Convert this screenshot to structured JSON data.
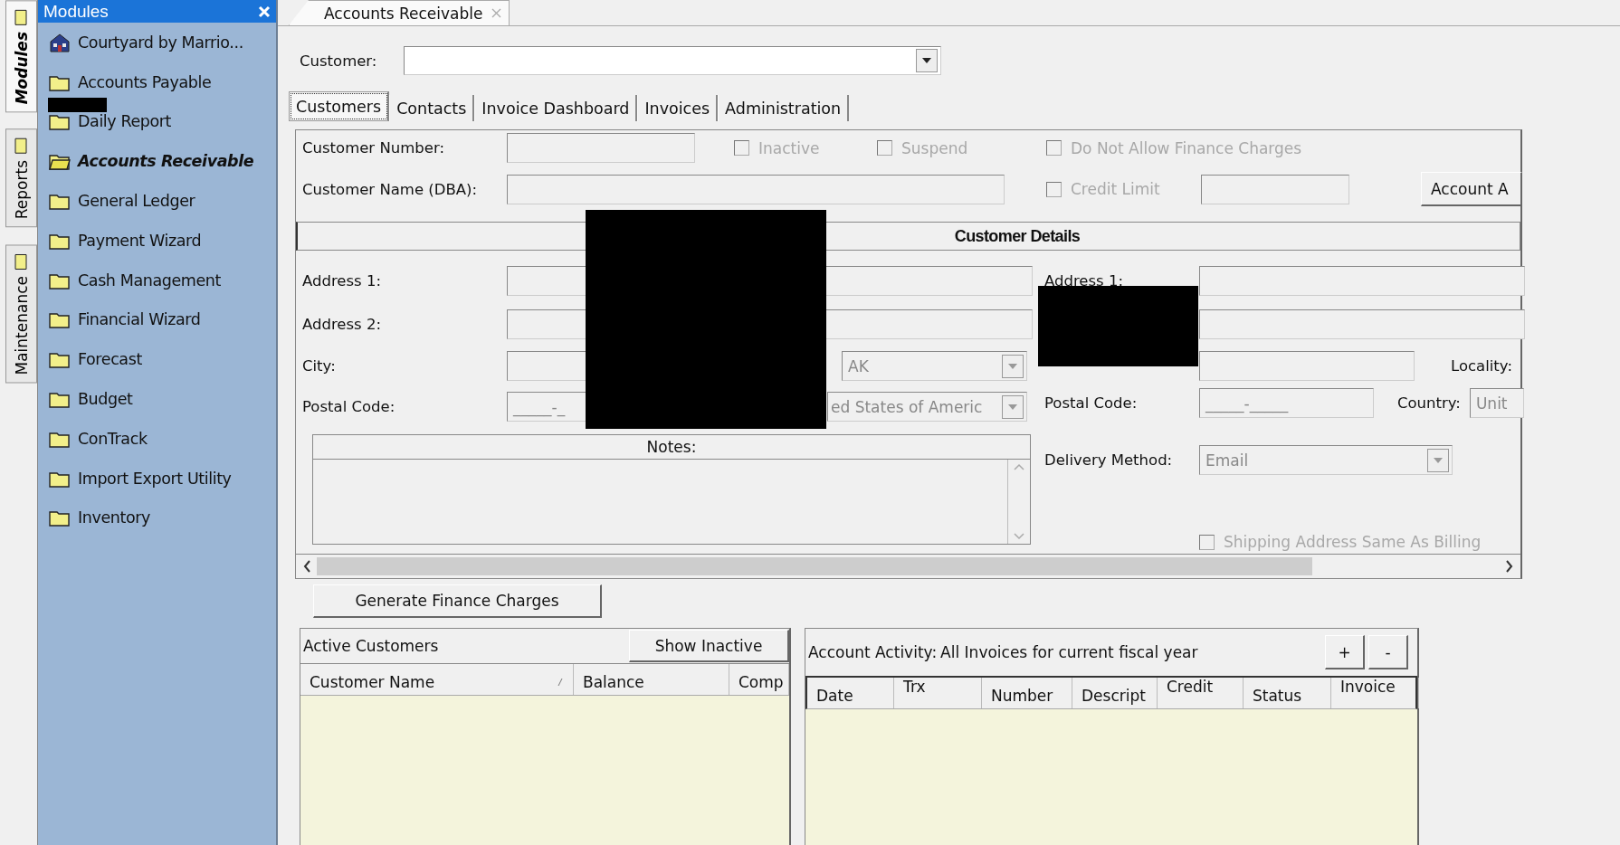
{
  "side_tabs": [
    {
      "label": "Modules",
      "selected": true
    },
    {
      "label": "Reports",
      "selected": false
    },
    {
      "label": "Maintenance",
      "selected": false
    }
  ],
  "sidebar": {
    "title": "Modules",
    "items": [
      {
        "label": "Courtyard by Marrio...",
        "kind": "property",
        "selected": false
      },
      {
        "label": "Accounts Payable",
        "kind": "folder",
        "selected": false
      },
      {
        "label": "Daily Report",
        "kind": "folder",
        "selected": false
      },
      {
        "label": "Accounts Receivable",
        "kind": "folder",
        "selected": true
      },
      {
        "label": "General Ledger",
        "kind": "folder",
        "selected": false
      },
      {
        "label": "Payment Wizard",
        "kind": "folder",
        "selected": false
      },
      {
        "label": "Cash Management",
        "kind": "folder",
        "selected": false
      },
      {
        "label": "Financial Wizard",
        "kind": "folder",
        "selected": false
      },
      {
        "label": "Forecast",
        "kind": "folder",
        "selected": false
      },
      {
        "label": "Budget",
        "kind": "folder",
        "selected": false
      },
      {
        "label": "ConTrack",
        "kind": "folder",
        "selected": false
      },
      {
        "label": "Import Export Utility",
        "kind": "folder",
        "selected": false
      },
      {
        "label": "Inventory",
        "kind": "folder",
        "selected": false
      }
    ]
  },
  "document_tab": {
    "label": "Accounts Receivable"
  },
  "customer": {
    "label": "Customer:"
  },
  "tabs": [
    {
      "label": "Customers",
      "selected": true
    },
    {
      "label": "Contacts",
      "selected": false
    },
    {
      "label": "Invoice Dashboard",
      "selected": false
    },
    {
      "label": "Invoices",
      "selected": false
    },
    {
      "label": "Administration",
      "selected": false
    }
  ],
  "form": {
    "customer_number": {
      "label": "Customer Number:"
    },
    "inactive": {
      "label": "Inactive",
      "checked": false,
      "disabled": true
    },
    "suspend": {
      "label": "Suspend",
      "checked": false,
      "disabled": true
    },
    "no_finance_charges": {
      "label": "Do Not Allow Finance Charges",
      "checked": false,
      "disabled": true
    },
    "customer_name": {
      "label": "Customer Name (DBA):"
    },
    "credit_limit": {
      "label": "Credit Limit",
      "checked": false,
      "disabled": true
    },
    "account_button": "Account A",
    "details_title": "Customer Details",
    "billing": {
      "address1": "Address 1:",
      "address2": "Address 2:",
      "city": "City:",
      "state_value": "AK",
      "postal_label": "Postal Code:",
      "postal_value": "_____-_",
      "country_value": "ed States of Americ"
    },
    "notes_label": "Notes:",
    "shipping": {
      "address1": "Address 1:",
      "locality": "Locality:",
      "postal_label": "Postal Code:",
      "postal_value": "_____-_____",
      "country_label": "Country:",
      "country_value": "Unit",
      "delivery_label": "Delivery Method:",
      "delivery_value": "Email"
    },
    "same_as_billing": {
      "label": "Shipping Address Same As Billing",
      "checked": false,
      "disabled": true
    }
  },
  "generate_button": "Generate Finance Charges",
  "active_customers": {
    "title": "Active Customers",
    "button": "Show Inactive",
    "columns": [
      "Customer Name",
      "Balance",
      "Comp"
    ]
  },
  "account_activity": {
    "label": "Account Activity:",
    "filter": "All Invoices for current fiscal year",
    "add": "+",
    "remove": "-",
    "columns": [
      "Date",
      "Trx",
      "Number",
      "Descript",
      "Credit",
      "Status",
      "Invoice"
    ]
  }
}
